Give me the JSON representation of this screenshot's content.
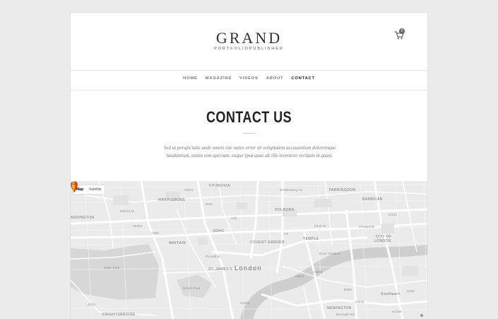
{
  "logo": {
    "title": "GRAND",
    "subtitle": "PORTFOLIOPUBLISHER"
  },
  "cart": {
    "count": "0",
    "icon": "cart-icon"
  },
  "nav": {
    "items": [
      {
        "label": "HOME"
      },
      {
        "label": "MAGAZINE"
      },
      {
        "label": "VIDEOS"
      },
      {
        "label": "ABOUT"
      },
      {
        "label": "CONTACT",
        "active": true
      }
    ]
  },
  "page": {
    "title": "CONTACT US",
    "intro_line1": "Sed ut perspiciatis unde omnis iste natus error sit voluptatem accusantium doloremque",
    "intro_line2": "laudantium, totam rem aperiam, eaque ipsa quae ab illo inventore veritatis et quasi."
  },
  "map": {
    "type_buttons": {
      "map": "Map",
      "satellite": "Satellite"
    },
    "city": "London",
    "districts": {
      "fitzrovia": "FITZROVIA",
      "marylebone": "MARYLEBONE",
      "holborn": "HOLBORN",
      "farringdon": "FARRINGDON",
      "barbican": "BARBICAN",
      "soho": "SOHO",
      "mayfair": "MAYFAIR",
      "covent_garden": "COVENT GARDEN",
      "temple": "TEMPLE",
      "city_of_london_1": "CITY OF",
      "city_of_london_2": "LONDON",
      "st_james": "ST. JAMES'S",
      "southwark": "Southwark",
      "newington": "NEWINGTON",
      "knightsbridge": "KNIGHTSBRIDGE",
      "paddington": "ADDINGTON",
      "hyde_park": "Hyde Park",
      "green_park": "Green Park"
    },
    "roads": {
      "a4201": "A4201",
      "a5204": "A5204",
      "a501": "A501",
      "a40": "A40",
      "a4": "A4",
      "a3211": "A3211",
      "a3200": "A3200",
      "a1211": "A1211",
      "a202": "A202",
      "a3212": "A3212",
      "a3216": "A3216",
      "b300": "B300",
      "a3036": "A3036",
      "a2198": "A2198",
      "a315": "A315",
      "a402": "A402",
      "a1": "A1",
      "strand": "Strand",
      "river_thames": "River Thames",
      "piccadilly": "Piccadilly",
      "fleet_st": "Fleet St",
      "cheapside": "Cheapside",
      "oxford_st": "Oxford St",
      "shaftesbury": "Shaftesbury Av",
      "borough_rd": "Borough Rd",
      "baker_st": "Baker St",
      "tower_br": "Tower Br"
    },
    "icons": {
      "pin": "location-pin-icon",
      "pegman": "pegman-icon",
      "zoom": "+"
    }
  }
}
